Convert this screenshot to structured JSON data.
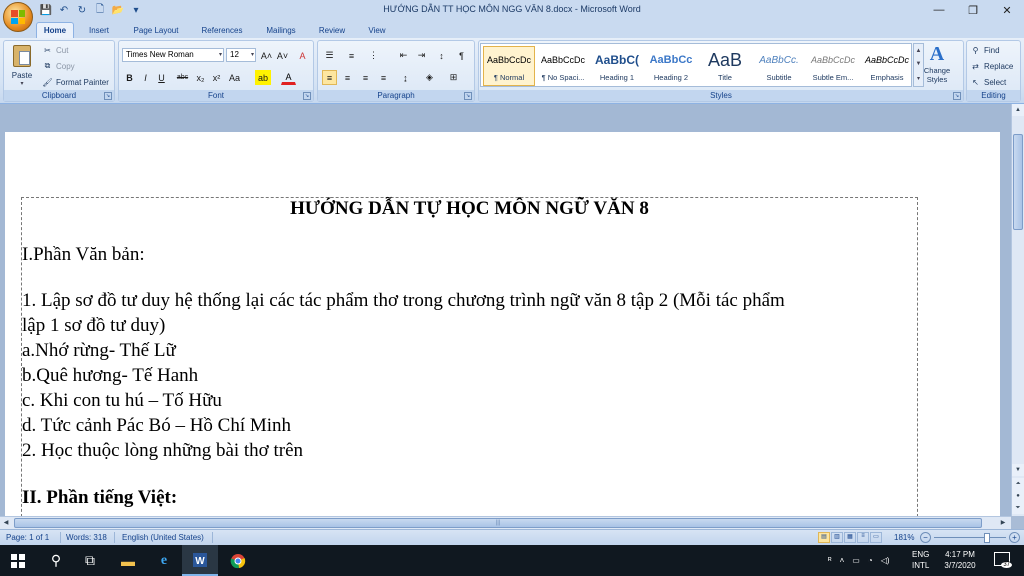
{
  "window": {
    "title": "HƯỚNG DẪN TT HỌC MÔN NGG VĂN 8.docx - Microsoft Word",
    "minimize": "—",
    "restore": "❐",
    "close": "✕"
  },
  "qat": {
    "save": "💾",
    "undo": "↶",
    "redo": "↻",
    "new": "🗋",
    "open": "📂",
    "more": "▾"
  },
  "tabs": [
    "Home",
    "Insert",
    "Page Layout",
    "References",
    "Mailings",
    "Review",
    "View"
  ],
  "ribbon": {
    "clipboard": {
      "label": "Clipboard",
      "paste": "Paste",
      "cut": "Cut",
      "copy": "Copy",
      "format_painter": "Format Painter"
    },
    "font": {
      "label": "Font",
      "family": "Times New Roman",
      "size": "12",
      "grow": "A˄",
      "shrink": "A˅",
      "clear": "A",
      "bold": "B",
      "italic": "I",
      "underline": "U",
      "strike": "abc",
      "subscript": "x₂",
      "superscript": "x²",
      "case": "Aa",
      "highlight": "ab",
      "color": "A"
    },
    "paragraph": {
      "label": "Paragraph"
    },
    "styles": {
      "label": "Styles",
      "items": [
        {
          "sample": "AaBbCcDc",
          "name": "¶ Normal"
        },
        {
          "sample": "AaBbCcDc",
          "name": "¶ No Spaci..."
        },
        {
          "sample": "AaBbC(",
          "name": "Heading 1"
        },
        {
          "sample": "AaBbCc",
          "name": "Heading 2"
        },
        {
          "sample": "AaB",
          "name": "Title"
        },
        {
          "sample": "AaBbCc.",
          "name": "Subtitle"
        },
        {
          "sample": "AaBbCcDc",
          "name": "Subtle Em..."
        },
        {
          "sample": "AaBbCcDc",
          "name": "Emphasis"
        }
      ],
      "change_styles": "Change Styles"
    },
    "editing": {
      "label": "Editing",
      "find": "Find",
      "replace": "Replace",
      "select": "Select"
    }
  },
  "document": {
    "heading": "HƯỚNG DẪN TỰ HỌC MÔN NGỮ VĂN 8",
    "lines": [
      "I.Phần Văn bản:",
      "1. Lập sơ đồ tư duy hệ thống lại các tác phẩm thơ trong chương trình ngữ văn 8 tập 2 (Mỗi tác phẩm",
      "lập 1 sơ đồ tư duy)",
      "a.Nhớ rừng- Thế Lữ",
      "b.Quê hương- Tế Hanh",
      "c. Khi con tu hú – Tố Hữu",
      "d. Tức cảnh Pác Bó – Hồ Chí Minh",
      "2. Học thuộc lòng những bài thơ trên"
    ],
    "section2": "II. Phần tiếng Việt:"
  },
  "status": {
    "page": "Page: 1 of 1",
    "words": "Words: 318",
    "language": "English (United States)",
    "zoom": "181%"
  },
  "taskbar": {
    "lang1": "ENG",
    "lang2": "INTL",
    "time": "4:17 PM",
    "date": "3/7/2020",
    "notifications": "37"
  },
  "colors": {
    "ribbon_bg": "#d5e3f4",
    "page_bg": "#ffffff",
    "doc_bg": "#a3b8d4",
    "taskbar": "#101820"
  }
}
